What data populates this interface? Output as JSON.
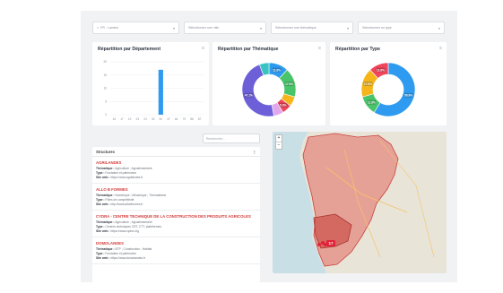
{
  "filters": [
    {
      "value": "FR - Landes",
      "prefix": "×"
    },
    {
      "value": "Sélectionner une ville"
    },
    {
      "value": "Sélectionner une thématique"
    },
    {
      "value": "Sélectionner un type"
    }
  ],
  "bar_card": {
    "title": "Répartition par Département",
    "menu": "≡"
  },
  "theme_card": {
    "title": "Répartition par Thématique",
    "menu": "≡"
  },
  "type_card": {
    "title": "Répartition par Type",
    "menu": "≡"
  },
  "search": {
    "placeholder": "Rechercher..."
  },
  "list": {
    "header": "Structures",
    "header_icon": "⋮",
    "entries": [
      {
        "name": "AGRILANDES",
        "theme_label": "Thématique :",
        "theme": "Agriculture ; Agroalimentaire",
        "type_label": "Type :",
        "type": "Fondation et patrimoine",
        "web_label": "Site web :",
        "web": "https://www.agrilandes.fr"
      },
      {
        "name": "ALLO B FORMES",
        "theme_label": "Thématique :",
        "theme": "Numérique ; Mécanique ; Thermalisme",
        "type_label": "Type :",
        "type": "Pôles de compétitivité",
        "web_label": "Site web :",
        "web": "http://www.allobformes.fr"
      },
      {
        "name": "CYDRA - CENTRE TECHNIQUE DE LA CONSTRUCTION DES PRODUITS AGRICOLES",
        "theme_label": "Thématique :",
        "theme": "Agriculture ; Agroalimentaire",
        "type_label": "Type :",
        "type": "Centres techniques CRT, CTT, plateformes",
        "web_label": "Site web :",
        "web": "https://www.cydra.org"
      },
      {
        "name": "DOMOLANDES",
        "theme_label": "Thématique :",
        "theme": "BTP ; Construction ; Habitat",
        "type_label": "Type :",
        "type": "Fondation et patrimoine",
        "web_label": "Site web :",
        "web": "https://www.domolandes.fr"
      }
    ]
  },
  "map": {
    "zoom_in": "+",
    "zoom_out": "−",
    "marker_label": "17"
  },
  "colors": {
    "blue": "#2e9bf0",
    "green": "#49c46b",
    "yellow": "#f5b51b",
    "red": "#f0455a",
    "purple": "#6d5fd8",
    "region": "#e36a63"
  },
  "chart_data": [
    {
      "type": "bar",
      "title": "Répartition par Département",
      "categories": [
        "16",
        "17",
        "19",
        "23",
        "24",
        "33",
        "40",
        "47",
        "64",
        "79",
        "86",
        "87"
      ],
      "values": [
        0,
        0,
        0,
        0,
        0,
        0,
        17,
        0,
        0,
        0,
        0,
        0
      ],
      "yticks": [
        "0",
        "5",
        "10",
        "15",
        "20"
      ],
      "ylim": [
        0,
        20
      ],
      "grid": true
    },
    {
      "type": "pie",
      "title": "Répartition par Thématique",
      "donut": true,
      "values": [
        11.8,
        17.6,
        5.9,
        5.9,
        5.9,
        47.1,
        5.8
      ],
      "labels": [
        "11.8%",
        "17.6%",
        "",
        "5.9%",
        "",
        "47.1%",
        ""
      ]
    },
    {
      "type": "pie",
      "title": "Répartition par Type",
      "donut": true,
      "values": [
        58.8,
        11.8,
        17.6,
        11.8
      ],
      "labels": [
        "58.8%",
        "11.8%",
        "17.6%",
        "11.8%"
      ]
    }
  ]
}
